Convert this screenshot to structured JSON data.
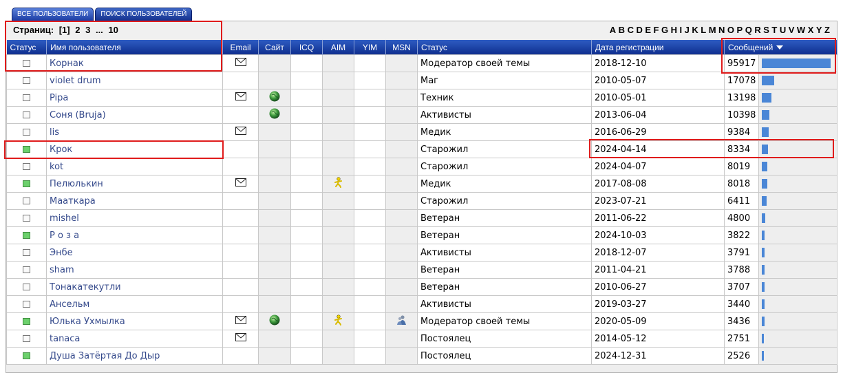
{
  "tabs": [
    {
      "label": "Все пользователи"
    },
    {
      "label": "Поиск пользователей"
    }
  ],
  "pager": {
    "label": "Страниц:",
    "pages": [
      "[1]",
      "2",
      "3",
      "...",
      "10"
    ]
  },
  "alphabet": [
    "A",
    "B",
    "C",
    "D",
    "E",
    "F",
    "G",
    "H",
    "I",
    "J",
    "K",
    "L",
    "M",
    "N",
    "O",
    "P",
    "Q",
    "R",
    "S",
    "T",
    "U",
    "V",
    "W",
    "X",
    "Y",
    "Z"
  ],
  "columns": {
    "status": "Статус",
    "username": "Имя пользователя",
    "email": "Email",
    "site": "Сайт",
    "icq": "ICQ",
    "aim": "AIM",
    "yim": "YIM",
    "msn": "MSN",
    "rank": "Статус",
    "regdate": "Дата регистрации",
    "posts": "Сообщений"
  },
  "icons": {
    "email": "envelope-icon",
    "site": "globe-icon",
    "aim": "aim-runner-icon",
    "msn": "msn-icon",
    "sort": "sort-desc-icon"
  },
  "colors": {
    "header": "#1c46ad",
    "link": "#34498b",
    "online": "#6cd06c",
    "bar": "#4a86d6",
    "highlight": "#e01b1b"
  },
  "rows": [
    {
      "online": false,
      "name": "Корнак",
      "email": true,
      "site": false,
      "aim": false,
      "msn": false,
      "rank": "Модератор своей темы",
      "regdate": "2018-12-10",
      "posts": 95917
    },
    {
      "online": false,
      "name": "violet drum",
      "email": false,
      "site": false,
      "aim": false,
      "msn": false,
      "rank": "Маг",
      "regdate": "2010-05-07",
      "posts": 17078
    },
    {
      "online": false,
      "name": "Pipa",
      "email": true,
      "site": true,
      "aim": false,
      "msn": false,
      "rank": "Техник",
      "regdate": "2010-05-01",
      "posts": 13198
    },
    {
      "online": false,
      "name": "Соня (Bruja)",
      "email": false,
      "site": true,
      "aim": false,
      "msn": false,
      "rank": "Активисты",
      "regdate": "2013-06-04",
      "posts": 10398
    },
    {
      "online": false,
      "name": "lis",
      "email": true,
      "site": false,
      "aim": false,
      "msn": false,
      "rank": "Медик",
      "regdate": "2016-06-29",
      "posts": 9384
    },
    {
      "online": true,
      "name": "Крок",
      "email": false,
      "site": false,
      "aim": false,
      "msn": false,
      "rank": "Старожил",
      "regdate": "2024-04-14",
      "posts": 8334
    },
    {
      "online": false,
      "name": "kot",
      "email": false,
      "site": false,
      "aim": false,
      "msn": false,
      "rank": "Старожил",
      "regdate": "2024-04-07",
      "posts": 8019
    },
    {
      "online": true,
      "name": "Пелюлькин",
      "email": true,
      "site": false,
      "aim": true,
      "msn": false,
      "rank": "Медик",
      "regdate": "2017-08-08",
      "posts": 8018
    },
    {
      "online": false,
      "name": "Мааткара",
      "email": false,
      "site": false,
      "aim": false,
      "msn": false,
      "rank": "Старожил",
      "regdate": "2023-07-21",
      "posts": 6411
    },
    {
      "online": false,
      "name": "mishel",
      "email": false,
      "site": false,
      "aim": false,
      "msn": false,
      "rank": "Ветеран",
      "regdate": "2011-06-22",
      "posts": 4800
    },
    {
      "online": true,
      "name": "Р о з а",
      "email": false,
      "site": false,
      "aim": false,
      "msn": false,
      "rank": "Ветеран",
      "regdate": "2024-10-03",
      "posts": 3822
    },
    {
      "online": false,
      "name": "Энбе",
      "email": false,
      "site": false,
      "aim": false,
      "msn": false,
      "rank": "Активисты",
      "regdate": "2018-12-07",
      "posts": 3791
    },
    {
      "online": false,
      "name": "sham",
      "email": false,
      "site": false,
      "aim": false,
      "msn": false,
      "rank": "Ветеран",
      "regdate": "2011-04-21",
      "posts": 3788
    },
    {
      "online": false,
      "name": "Тонакатекутли",
      "email": false,
      "site": false,
      "aim": false,
      "msn": false,
      "rank": "Ветеран",
      "regdate": "2010-06-27",
      "posts": 3707
    },
    {
      "online": false,
      "name": "Ансельм",
      "email": false,
      "site": false,
      "aim": false,
      "msn": false,
      "rank": "Активисты",
      "regdate": "2019-03-27",
      "posts": 3440
    },
    {
      "online": true,
      "name": "Юлька Ухмылка",
      "email": true,
      "site": true,
      "aim": true,
      "msn": true,
      "rank": "Модератор своей темы",
      "regdate": "2020-05-09",
      "posts": 3436
    },
    {
      "online": false,
      "name": "tanaca",
      "email": true,
      "site": false,
      "aim": false,
      "msn": false,
      "rank": "Постоялец",
      "regdate": "2014-05-12",
      "posts": 2751
    },
    {
      "online": true,
      "name": "Душа Затёртая До Дыр",
      "email": false,
      "site": false,
      "aim": false,
      "msn": false,
      "rank": "Постоялец",
      "regdate": "2024-12-31",
      "posts": 2526
    }
  ]
}
